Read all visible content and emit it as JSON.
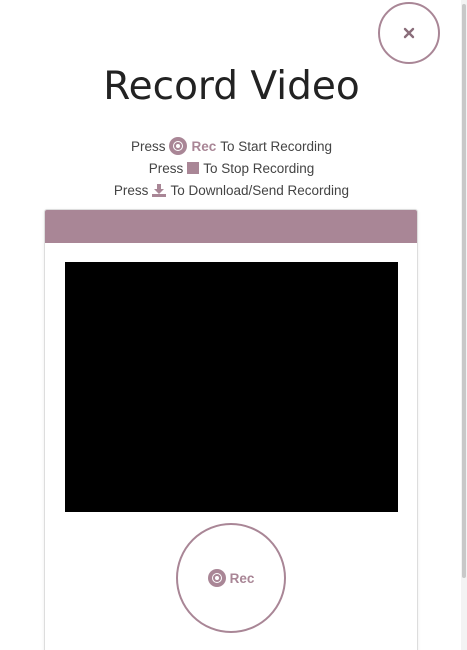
{
  "colors": {
    "accent": "#a98696",
    "video_background": "#000000",
    "title_text": "#222222"
  },
  "close_button": {
    "icon": "close-icon"
  },
  "title": "Record Video",
  "instructions": {
    "line1": {
      "prefix": "Press",
      "icon": "record-icon",
      "keyword": "Rec",
      "suffix": "To Start Recording"
    },
    "line2": {
      "prefix": "Press",
      "icon": "stop-icon",
      "suffix": "To Stop Recording"
    },
    "line3": {
      "prefix": "Press",
      "icon": "download-icon",
      "suffix": "To Download/Send Recording"
    }
  },
  "recorder": {
    "record_button": {
      "icon": "record-icon",
      "label": "Rec"
    }
  }
}
